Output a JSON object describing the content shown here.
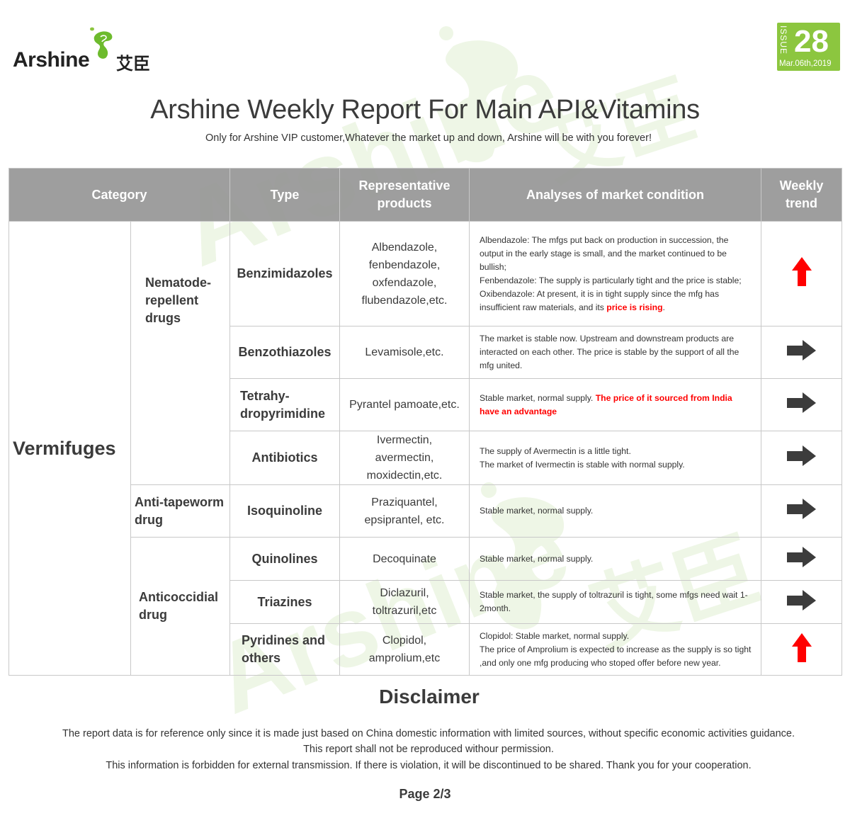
{
  "header": {
    "logo_text": "Arshine",
    "logo_cn": "艾臣",
    "issue_label": "ISSUE",
    "issue_number": "28",
    "issue_date": "Mar.06th,2019",
    "title": "Arshine Weekly Report For Main API&Vitamins",
    "subtitle": "Only for Arshine VIP customer,Whatever the market up and down, Arshine will be with you forever!"
  },
  "watermark": {
    "text": "Arshine",
    "cn": "艾臣"
  },
  "colors": {
    "accent_green": "#8cc63f",
    "header_gray": "#9b9b9b",
    "up_red": "#ff0000",
    "flat_dark": "#3c3c3c"
  },
  "table": {
    "headers": {
      "category": "Category",
      "type": "Type",
      "products": "Representative products",
      "analysis": "Analyses of market condition",
      "trend": "Weekly trend"
    },
    "category_main": "Vermifuges",
    "subcategories": {
      "nematode": "Nematode-repellent drugs",
      "tapeworm": "Anti-tapeworm drug",
      "coccidial": "Anticoccidial drug"
    },
    "rows": [
      {
        "type": "Benzimidazoles",
        "products": "Albendazole, fenbendazole, oxfendazole, flubendazole,etc.",
        "analysis": [
          {
            "text": "Albendazole: The mfgs put back on production in succession, the output in the early stage is small, and the market continued to be bullish;"
          },
          {
            "text": "Fenbendazole: The supply is particularly tight and the price is stable;"
          },
          {
            "text": "Oxibendazole: At present, it is in tight supply since the mfg has insufficient raw materials, and its ",
            "highlight": "price is rising",
            "after": "."
          }
        ],
        "trend": "up"
      },
      {
        "type": "Benzothiazoles",
        "products": "Levamisole,etc.",
        "analysis": [
          {
            "text": "The market is stable now. Upstream and downstream products are interacted on each other. The price is stable by the support of all the mfg united."
          }
        ],
        "trend": "flat"
      },
      {
        "type": "Tetrahy-dropyrimidine",
        "products": "Pyrantel pamoate,etc.",
        "analysis": [
          {
            "text": "Stable market, normal supply. ",
            "highlight": "The price of it sourced from India have an advantage"
          }
        ],
        "trend": "flat"
      },
      {
        "type": "Antibiotics",
        "products": "Ivermectin, avermectin, moxidectin,etc.",
        "analysis": [
          {
            "text": "The supply of Avermectin is a little tight."
          },
          {
            "text": "The market of Ivermectin is stable with normal supply."
          }
        ],
        "trend": "flat"
      },
      {
        "type": "Isoquinoline",
        "products": "Praziquantel, epsiprantel, etc.",
        "analysis": [
          {
            "text": "Stable market, normal supply."
          }
        ],
        "trend": "flat"
      },
      {
        "type": "Quinolines",
        "products": "Decoquinate",
        "analysis": [
          {
            "text": "Stable market, normal supply."
          }
        ],
        "trend": "flat"
      },
      {
        "type": "Triazines",
        "products": "Diclazuril, toltrazuril,etc",
        "analysis": [
          {
            "text": "Stable market, the supply of toltrazuril  is tight, some mfgs need wait 1-2month."
          }
        ],
        "trend": "flat"
      },
      {
        "type": "Pyridines and others",
        "products": "Clopidol, amprolium,etc",
        "analysis": [
          {
            "text": "Clopidol: Stable market, normal supply."
          },
          {
            "text": "The price of Amprolium is expected to increase as the supply is so tight ,and only one mfg producing who stoped offer before new year."
          }
        ],
        "trend": "up"
      }
    ]
  },
  "disclaimer": {
    "title": "Disclaimer",
    "lines": [
      "The report data is for reference only since it is made just based on China domestic information with limited sources, without specific economic activities guidance.",
      "This report shall not be reproduced withour permission.",
      "This information is forbidden for external transmission. If there is violation, it will be discontinued to be shared. Thank you for your cooperation."
    ]
  },
  "footer": {
    "page": "Page 2/3"
  }
}
